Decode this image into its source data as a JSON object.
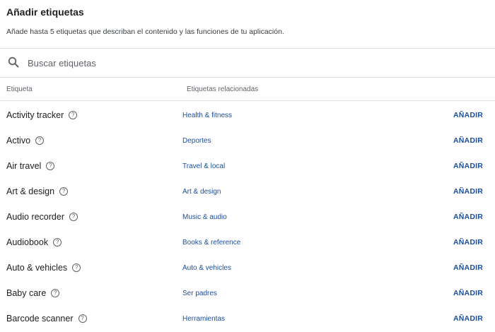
{
  "header": {
    "title": "Añadir etiquetas",
    "subtitle": "Añade hasta 5 etiquetas que describan el contenido y las funciones de tu aplicación."
  },
  "search": {
    "placeholder": "Buscar etiquetas",
    "icon": "search-icon"
  },
  "columns": {
    "tag": "Etiqueta",
    "related": "Etiquetas relacionadas"
  },
  "colors": {
    "link": "#1a4fa0",
    "text": "#202124",
    "divider": "#e0e0e0"
  },
  "rows": [
    {
      "tag": "Activity tracker",
      "related": "Health & fitness",
      "action": "AÑADIR"
    },
    {
      "tag": "Activo",
      "related": "Deportes",
      "action": "AÑADIR"
    },
    {
      "tag": "Air travel",
      "related": "Travel & local",
      "action": "AÑADIR"
    },
    {
      "tag": "Art & design",
      "related": "Art & design",
      "action": "AÑADIR"
    },
    {
      "tag": "Audio recorder",
      "related": "Music & audio",
      "action": "AÑADIR"
    },
    {
      "tag": "Audiobook",
      "related": "Books & reference",
      "action": "AÑADIR"
    },
    {
      "tag": "Auto & vehicles",
      "related": "Auto & vehicles",
      "action": "AÑADIR"
    },
    {
      "tag": "Baby care",
      "related": "Ser padres",
      "action": "AÑADIR"
    },
    {
      "tag": "Barcode scanner",
      "related": "Herramientas",
      "action": "AÑADIR"
    }
  ]
}
